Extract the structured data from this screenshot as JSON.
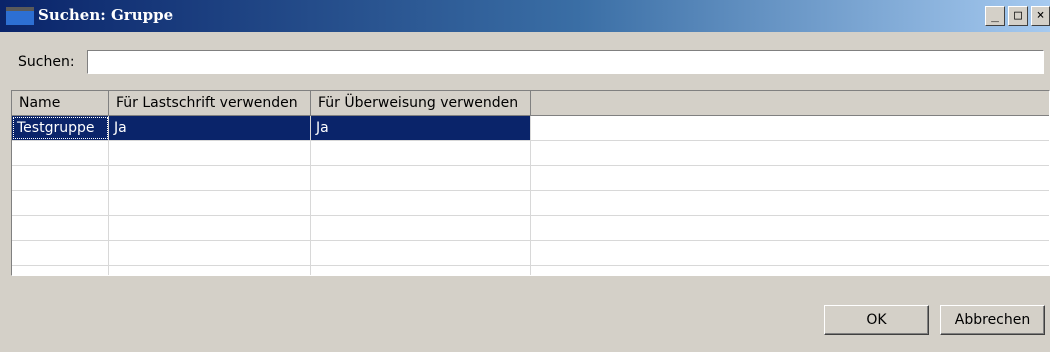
{
  "window": {
    "title": "Suchen: Gruppe",
    "controls": {
      "minimize": "_",
      "maximize": "□",
      "close": "×"
    }
  },
  "search": {
    "label": "Suchen:",
    "value": ""
  },
  "table": {
    "columns": [
      "Name",
      "Für Lastschrift verwenden",
      "Für Überweisung verwenden"
    ],
    "rows": [
      {
        "name": "Testgruppe",
        "lastschrift": "Ja",
        "ueberweisung": "Ja",
        "selected": true
      }
    ]
  },
  "buttons": {
    "ok": "OK",
    "cancel": "Abbrechen"
  },
  "colors": {
    "selection": "#0a246a",
    "titlebar_start": "#0a246a",
    "titlebar_end": "#a6caf0"
  }
}
